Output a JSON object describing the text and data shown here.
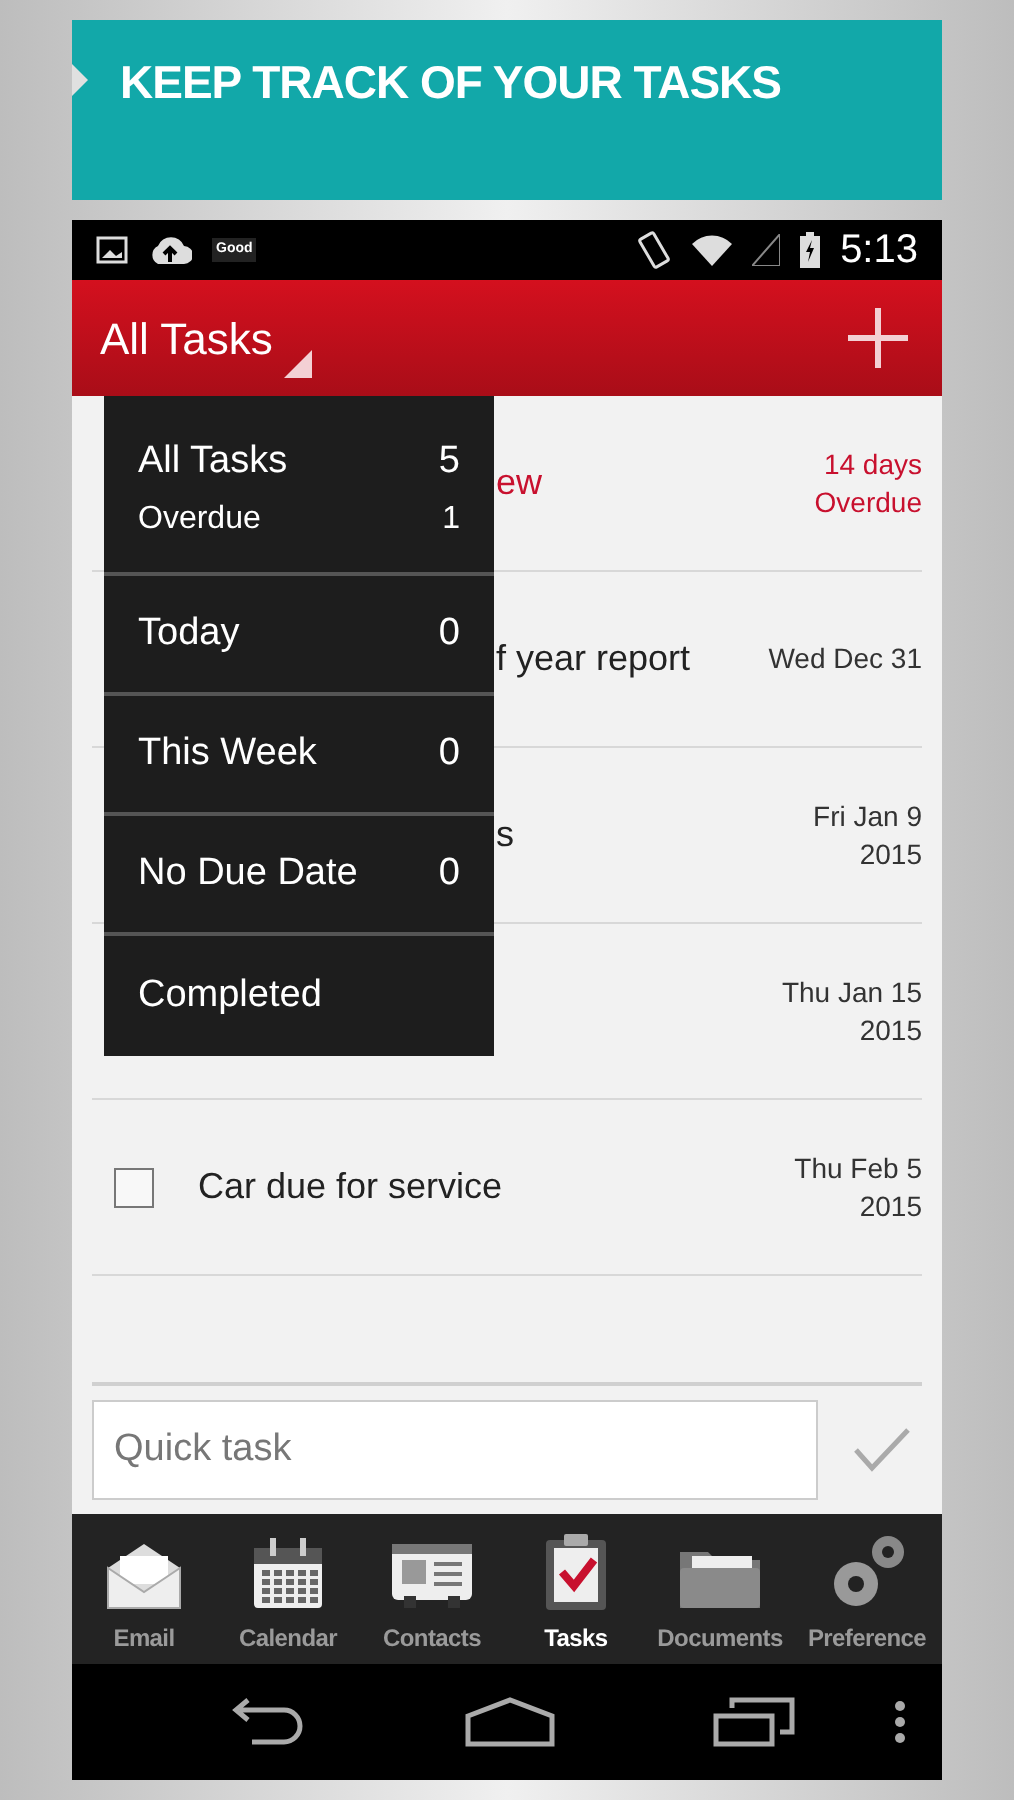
{
  "banner": {
    "title": "KEEP TRACK OF YOUR TASKS"
  },
  "status_bar": {
    "notification": "Good",
    "time": "5:13"
  },
  "app_bar": {
    "title": "All Tasks"
  },
  "filters": [
    {
      "label": "All Tasks",
      "count": "5",
      "kind": "main"
    },
    {
      "label": "Overdue",
      "count": "1",
      "kind": "sub"
    },
    {
      "label": "Today",
      "count": "0",
      "kind": "item"
    },
    {
      "label": "This Week",
      "count": "0",
      "kind": "item"
    },
    {
      "label": "No Due Date",
      "count": "0",
      "kind": "item"
    },
    {
      "label": "Completed",
      "kind": "item"
    }
  ],
  "tasks": [
    {
      "kind": "partial",
      "title": "ew",
      "due": [
        "14 days",
        "Overdue"
      ],
      "overdue": true
    },
    {
      "kind": "partial",
      "title": "f year report",
      "due": [
        "Wed Dec 31"
      ],
      "overdue": false
    },
    {
      "kind": "partial",
      "title": "s",
      "due": [
        "Fri Jan 9",
        "2015"
      ],
      "overdue": false
    },
    {
      "kind": "partial",
      "due": [
        "Thu Jan 15",
        "2015"
      ],
      "overdue": false
    },
    {
      "kind": "full",
      "title": "Car due for service",
      "due": [
        "Thu Feb 5",
        "2015"
      ],
      "overdue": false,
      "checked": false
    }
  ],
  "quick_task": {
    "placeholder": "Quick task"
  },
  "nav": [
    {
      "label": "Email",
      "kind": "email",
      "selected": false
    },
    {
      "label": "Calendar",
      "kind": "calendar",
      "selected": false
    },
    {
      "label": "Contacts",
      "kind": "contacts",
      "selected": false
    },
    {
      "label": "Tasks",
      "kind": "tasks",
      "selected": true
    },
    {
      "label": "Documents",
      "kind": "documents",
      "selected": false
    },
    {
      "label": "Preference",
      "kind": "preferences",
      "selected": false
    }
  ]
}
